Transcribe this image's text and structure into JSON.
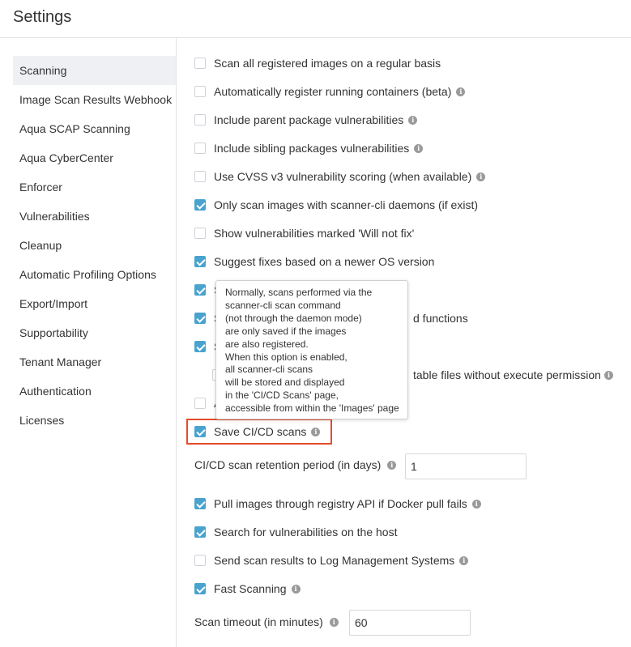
{
  "header": {
    "title": "Settings"
  },
  "sidebar": {
    "items": [
      {
        "label": "Scanning",
        "active": true
      },
      {
        "label": "Image Scan Results Webhook"
      },
      {
        "label": "Aqua SCAP Scanning"
      },
      {
        "label": "Aqua CyberCenter"
      },
      {
        "label": "Enforcer"
      },
      {
        "label": "Vulnerabilities"
      },
      {
        "label": "Cleanup"
      },
      {
        "label": "Automatic Profiling Options"
      },
      {
        "label": "Export/Import"
      },
      {
        "label": "Supportability"
      },
      {
        "label": "Tenant Manager"
      },
      {
        "label": "Authentication"
      },
      {
        "label": "Licenses"
      }
    ]
  },
  "options": [
    {
      "label": "Scan all registered images on a regular basis",
      "checked": false,
      "info": false
    },
    {
      "label": "Automatically register running containers (beta)",
      "checked": false,
      "info": true
    },
    {
      "label": "Include parent package vulnerabilities",
      "checked": false,
      "info": true
    },
    {
      "label": "Include sibling packages vulnerabilities",
      "checked": false,
      "info": true
    },
    {
      "label": "Use CVSS v3 vulnerability scoring (when available)",
      "checked": false,
      "info": true
    },
    {
      "label": "Only scan images with scanner-cli daemons (if exist)",
      "checked": true,
      "info": false
    },
    {
      "label": "Show vulnerabilities marked 'Will not fix'",
      "checked": false,
      "info": false
    },
    {
      "label": "Suggest fixes based on a newer OS version",
      "checked": true,
      "info": false
    },
    {
      "label": "S",
      "checked": true,
      "info": false
    },
    {
      "label": "S",
      "suffix": "d functions",
      "checked": true,
      "info": false
    },
    {
      "label": "S",
      "checked": true,
      "info": false
    },
    {
      "label": "",
      "suffix": "table files without execute permission",
      "checked": false,
      "info": true
    },
    {
      "label": "A",
      "checked": false,
      "info": false
    },
    {
      "label": "Save CI/CD scans",
      "checked": true,
      "info": true
    },
    {
      "label": "Pull images through registry API if Docker pull fails",
      "checked": true,
      "info": true
    },
    {
      "label": "Search for vulnerabilities on the host",
      "checked": true,
      "info": false
    },
    {
      "label": "Send scan results to Log Management Systems",
      "checked": false,
      "info": true
    },
    {
      "label": "Fast Scanning",
      "checked": true,
      "info": true
    }
  ],
  "retention": {
    "label": "CI/CD scan retention period (in days)",
    "value": "1"
  },
  "timeout": {
    "label": "Scan timeout (in minutes)",
    "value": "60"
  },
  "tooltip": {
    "lines": [
      "Normally, scans performed via the",
      "scanner-cli scan command",
      "(not through the daemon mode)",
      "are only saved if the images",
      "are also registered.",
      "When this option is enabled,",
      "all scanner-cli scans",
      "will be stored and displayed",
      "in the 'CI/CD Scans' page,",
      "accessible from within the 'Images' page"
    ]
  },
  "info_glyph": "i",
  "colors": {
    "accent": "#4aa3cf",
    "highlight": "#e44c2c",
    "active_bg": "#eef0f3"
  }
}
